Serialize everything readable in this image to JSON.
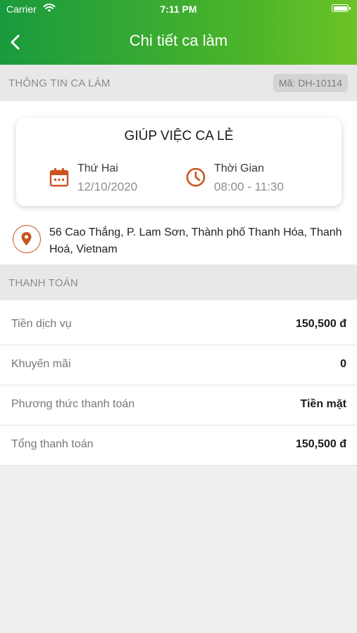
{
  "status_bar": {
    "carrier": "Carrier",
    "time": "7:11 PM"
  },
  "header": {
    "title": "Chi tiết ca làm"
  },
  "shift_info": {
    "section_title": "THÔNG TIN CA LÀM",
    "code": "Mã: DH-10114",
    "card": {
      "title": "GIÚP VIỆC CA LẺ",
      "date_label": "Thứ Hai",
      "date_value": "12/10/2020",
      "time_label": "Thời Gian",
      "time_value": "08:00 - 11:30"
    },
    "address": "56 Cao Thắng, P. Lam Sơn, Thành phố Thanh Hóa, Thanh Hoá, Vietnam"
  },
  "payment": {
    "section_title": "THANH TOÁN",
    "rows": [
      {
        "label": "Tiền dịch vụ",
        "value": "150,500 đ"
      },
      {
        "label": "Khuyến mãi",
        "value": "0"
      },
      {
        "label": "Phương thức thanh toán",
        "value": "Tiền mặt"
      },
      {
        "label": "Tổng thanh toán",
        "value": "150,500 đ"
      }
    ]
  },
  "colors": {
    "header_start": "#1a9a3e",
    "header_end": "#6dc326",
    "accent_icon": "#c9541f"
  },
  "icons": [
    "wifi-icon",
    "battery-icon",
    "back-arrow-icon",
    "calendar-icon",
    "clock-icon",
    "location-pin-icon"
  ]
}
